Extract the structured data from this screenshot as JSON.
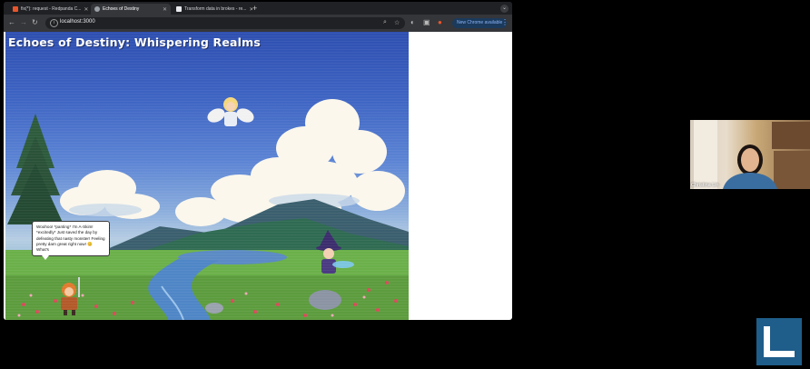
{
  "browser": {
    "tabs": [
      {
        "label": "fix(*): request - Redpanda C...",
        "favicon_color": "#e8552d",
        "active": false
      },
      {
        "label": "Echoes of Destiny",
        "favicon_color": "#9aa0a6",
        "active": true
      },
      {
        "label": "Transform data in brokes - re...",
        "favicon_color": "#e8eaed",
        "active": false
      }
    ],
    "url": "localhost:3000",
    "update_label": "New Chrome available"
  },
  "game": {
    "title": "Echoes of Destiny: Whispering Realms",
    "dialogue": "Woohoo! *panting* I'm A-Skim! *excitedly* Just saved the day by defeating that nasty monster! Feeling pretty darn great right now! 😊 What's"
  },
  "webcam": {
    "participant_name": "Christina Lin"
  },
  "colors": {
    "sky_top": "#2e4fb0",
    "chrome_dark": "#202124",
    "chrome_toolbar": "#35363a",
    "accent_blue": "#8ab4f8",
    "logo_blue": "#1f5d8a"
  }
}
